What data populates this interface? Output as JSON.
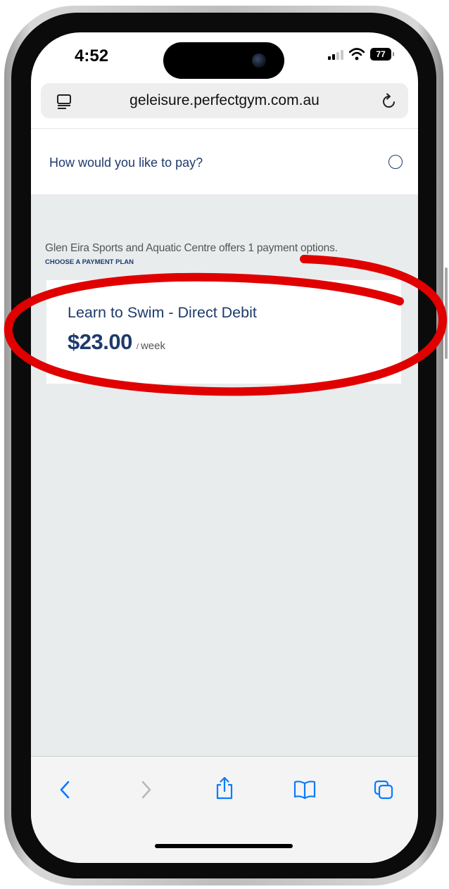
{
  "status_bar": {
    "time": "4:52",
    "battery": "77"
  },
  "browser": {
    "url": "geleisure.perfectgym.com.au"
  },
  "header": {
    "title": "How would you like to pay?",
    "close_symbol": "⊗"
  },
  "content": {
    "offer_text": "Glen Eira Sports and Aquatic Centre offers 1 payment options.",
    "choose_label": "CHOOSE A PAYMENT PLAN",
    "plans": [
      {
        "name": "Learn to Swim - Direct Debit",
        "price": "$23.00",
        "period": "week"
      }
    ]
  },
  "toolbar": {
    "icons": [
      "back-icon",
      "forward-icon",
      "share-icon",
      "bookmarks-icon",
      "tabs-icon"
    ]
  },
  "colors": {
    "brand_blue": "#1e3a6d",
    "content_bg": "#e9eced",
    "annotation_red": "#e00000",
    "ios_blue": "#0a7aff"
  }
}
